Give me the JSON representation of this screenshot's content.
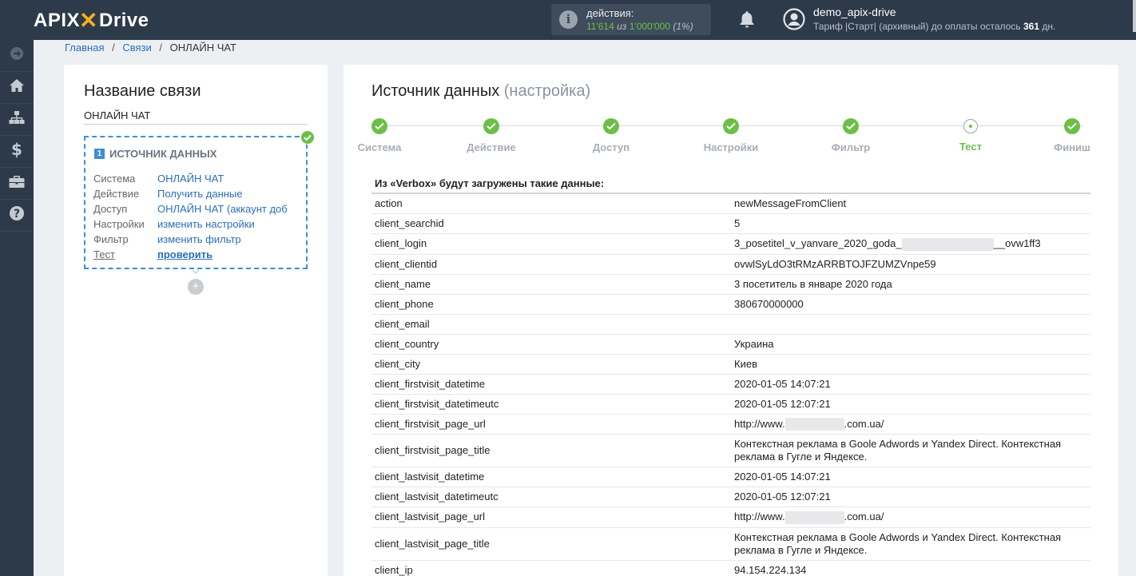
{
  "header": {
    "logo_left": "APIX",
    "logo_right": "Drive",
    "actions_label": "действия:",
    "actions_used": "11'614",
    "actions_of": "из",
    "actions_total": "1'000'000",
    "actions_percent": "(1%)",
    "username": "demo_apix-drive",
    "tariff_text": "Тариф |Старт| (архивный) до оплаты осталось",
    "tariff_days": "361",
    "tariff_unit": "дн."
  },
  "sidebar": {
    "items": [
      {
        "icon": "arrow-right-circle-icon"
      },
      {
        "icon": "home-icon"
      },
      {
        "icon": "sitemap-icon"
      },
      {
        "icon": "dollar-icon"
      },
      {
        "icon": "briefcase-icon"
      },
      {
        "icon": "question-circle-icon"
      }
    ]
  },
  "breadcrumb": {
    "home": "Главная",
    "links": "Связи",
    "current": "ОНЛАЙН ЧАТ",
    "separator": "/"
  },
  "left": {
    "title": "Название связи",
    "connection_name": "ОНЛАЙН ЧАТ",
    "step_number": "1",
    "step_title": "ИСТОЧНИК ДАННЫХ",
    "rows": [
      {
        "key": "Система",
        "value": "ОНЛАЙН ЧАТ"
      },
      {
        "key": "Действие",
        "value": "Получить данные"
      },
      {
        "key": "Доступ",
        "value": "ОНЛАЙН ЧАТ (аккаунт доб"
      },
      {
        "key": "Настройки",
        "value": "изменить настройки"
      },
      {
        "key": "Фильтр",
        "value": "изменить фильтр"
      },
      {
        "key": "Тест",
        "value": "проверить"
      }
    ],
    "plus": "+"
  },
  "right": {
    "title": "Источник данных",
    "subtitle": "(настройка)",
    "steps": [
      {
        "label": "Система",
        "state": "done"
      },
      {
        "label": "Действие",
        "state": "done"
      },
      {
        "label": "Доступ",
        "state": "done"
      },
      {
        "label": "Настройки",
        "state": "done"
      },
      {
        "label": "Фильтр",
        "state": "done"
      },
      {
        "label": "Тест",
        "state": "current"
      },
      {
        "label": "Финиш",
        "state": "done"
      }
    ],
    "data_title": "Из «Verbox» будут загружены такие данные:",
    "rows": [
      {
        "key": "action",
        "value": "newMessageFromClient"
      },
      {
        "key": "client_searchid",
        "value": "5"
      },
      {
        "key": "client_login",
        "value_prefix": "3_posetitel_v_yanvare_2020_goda_",
        "value_suffix": "__ovw1ff3"
      },
      {
        "key": "client_clientid",
        "value": "ovwlSyLdO3tRMzARRBTOJFZUMZVnpe59"
      },
      {
        "key": "client_name",
        "value": "3 посетитель в январе 2020 года"
      },
      {
        "key": "client_phone",
        "value": "380670000000"
      },
      {
        "key": "client_email",
        "value": ""
      },
      {
        "key": "client_country",
        "value": "Украина"
      },
      {
        "key": "client_city",
        "value": "Киев"
      },
      {
        "key": "client_firstvisit_datetime",
        "value": "2020-01-05 14:07:21"
      },
      {
        "key": "client_firstvisit_datetimeutc",
        "value": "2020-01-05 12:07:21"
      },
      {
        "key": "client_firstvisit_page_url",
        "value_prefix": "http://www.",
        "value_suffix": ".com.ua/"
      },
      {
        "key": "client_firstvisit_page_title",
        "value": "Контекстная реклама в Goole Adwords и Yandex Direct. Контекстная реклама в Гугле и Яндексе."
      },
      {
        "key": "client_lastvisit_datetime",
        "value": "2020-01-05 14:07:21"
      },
      {
        "key": "client_lastvisit_datetimeutc",
        "value": "2020-01-05 12:07:21"
      },
      {
        "key": "client_lastvisit_page_url",
        "value_prefix": "http://www.",
        "value_suffix": ".com.ua/"
      },
      {
        "key": "client_lastvisit_page_title",
        "value": "Контекстная реклама в Goole Adwords и Yandex Direct. Контекстная реклама в Гугле и Яндексе."
      },
      {
        "key": "client_ip",
        "value": "94.154.224.134"
      }
    ]
  },
  "colors": {
    "topbar": "#2d3a4a",
    "accent_green": "#6cbf45",
    "link_blue": "#2a6ebb",
    "dashed_blue": "#3d8fd8",
    "logo_x": "#f5b21b"
  }
}
